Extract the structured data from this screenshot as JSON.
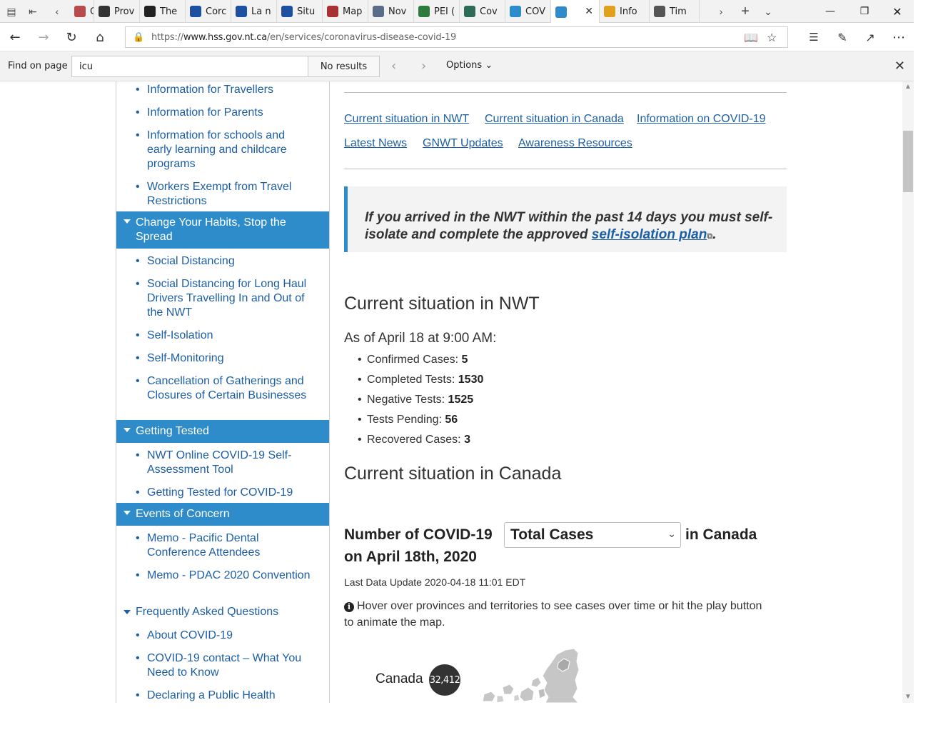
{
  "browser": {
    "tabs": [
      {
        "label": "Case",
        "color": "#b84b4b"
      },
      {
        "label": "Prov",
        "color": "#333333"
      },
      {
        "label": "The",
        "color": "#222222"
      },
      {
        "label": "Corc",
        "color": "#1f4fa0"
      },
      {
        "label": "La n",
        "color": "#1f4fa0"
      },
      {
        "label": "Situ",
        "color": "#1f4fa0"
      },
      {
        "label": "Map",
        "color": "#a83232"
      },
      {
        "label": "Nov",
        "color": "#5a6c88"
      },
      {
        "label": "PEI (",
        "color": "#2f7a3f"
      },
      {
        "label": "Cov",
        "color": "#2f6b56"
      },
      {
        "label": "COV",
        "color": "#2e8ccb"
      },
      {
        "label": "",
        "color": "#2e8ccb"
      },
      {
        "label": "Info",
        "color": "#e0a020"
      },
      {
        "label": "Tim",
        "color": "#555555"
      }
    ],
    "url_prefix": "https://",
    "url_domain": "www.hss.gov.nt.ca",
    "url_path": "/en/services/coronavirus-disease-covid-19"
  },
  "find_bar": {
    "label": "Find on page",
    "query": "icu",
    "result": "No results",
    "options_label": "Options"
  },
  "sidebar": {
    "items": [
      {
        "label": "Information for Travellers"
      },
      {
        "label": "Information for Parents"
      },
      {
        "label": "Information for schools and early learning and childcare programs"
      },
      {
        "label": "Workers Exempt from Travel Restrictions"
      },
      {
        "label": "Change Your Habits, Stop the Spread",
        "type": "section-header"
      },
      {
        "label": "Social Distancing"
      },
      {
        "label": "Social Distancing for Long Haul Drivers Travelling In and Out of the NWT"
      },
      {
        "label": "Self-Isolation"
      },
      {
        "label": "Self-Monitoring"
      },
      {
        "label": "Cancellation of Gatherings and Closures of Certain Businesses"
      },
      {
        "label": "Getting Tested",
        "type": "section-header"
      },
      {
        "label": "NWT Online COVID-19 Self-Assessment Tool"
      },
      {
        "label": "Getting Tested for COVID-19"
      },
      {
        "label": "Events of Concern",
        "type": "section-header"
      },
      {
        "label": "Memo - Pacific Dental Conference Attendees"
      },
      {
        "label": "Memo - PDAC 2020 Convention"
      },
      {
        "label": "Frequently Asked Questions",
        "type": "section-plain"
      },
      {
        "label": "About COVID-19"
      },
      {
        "label": "COVID-19 contact – What You Need to Know"
      },
      {
        "label": "Declaring a Public Health"
      }
    ]
  },
  "main": {
    "quick_links": [
      "Current situation in NWT",
      "Current situation in Canada",
      "Information on COVID-19",
      "Latest News",
      "GNWT Updates",
      "Awareness Resources"
    ],
    "alert": {
      "text": "If you arrived in the NWT within the past 14 days you must self-isolate and complete the approved ",
      "link": "self-isolation plan",
      "end": "."
    },
    "nwt": {
      "heading": "Current situation in NWT",
      "as_of": "As of April 18 at 9:00 AM:",
      "stats": [
        {
          "label": "Confirmed Cases: ",
          "value": "5"
        },
        {
          "label": "Completed Tests: ",
          "value": "1530"
        },
        {
          "label": "Negative Tests: ",
          "value": "1525"
        },
        {
          "label": "Tests Pending: ",
          "value": "56"
        },
        {
          "label": "Recovered Cases: ",
          "value": "3"
        }
      ]
    },
    "canada": {
      "heading": "Current situation in Canada",
      "number_prefix": "Number of COVID-19",
      "selected_metric": "Total Cases",
      "number_suffix": "in Canada",
      "date_line": "on April 18th, 2020",
      "last_update": "Last Data Update 2020-04-18 11:01 EDT",
      "hint": "Hover over provinces and territories to see cases over time or hit the play button to animate the map.",
      "country_label": "Canada",
      "country_total": "32,412"
    }
  }
}
